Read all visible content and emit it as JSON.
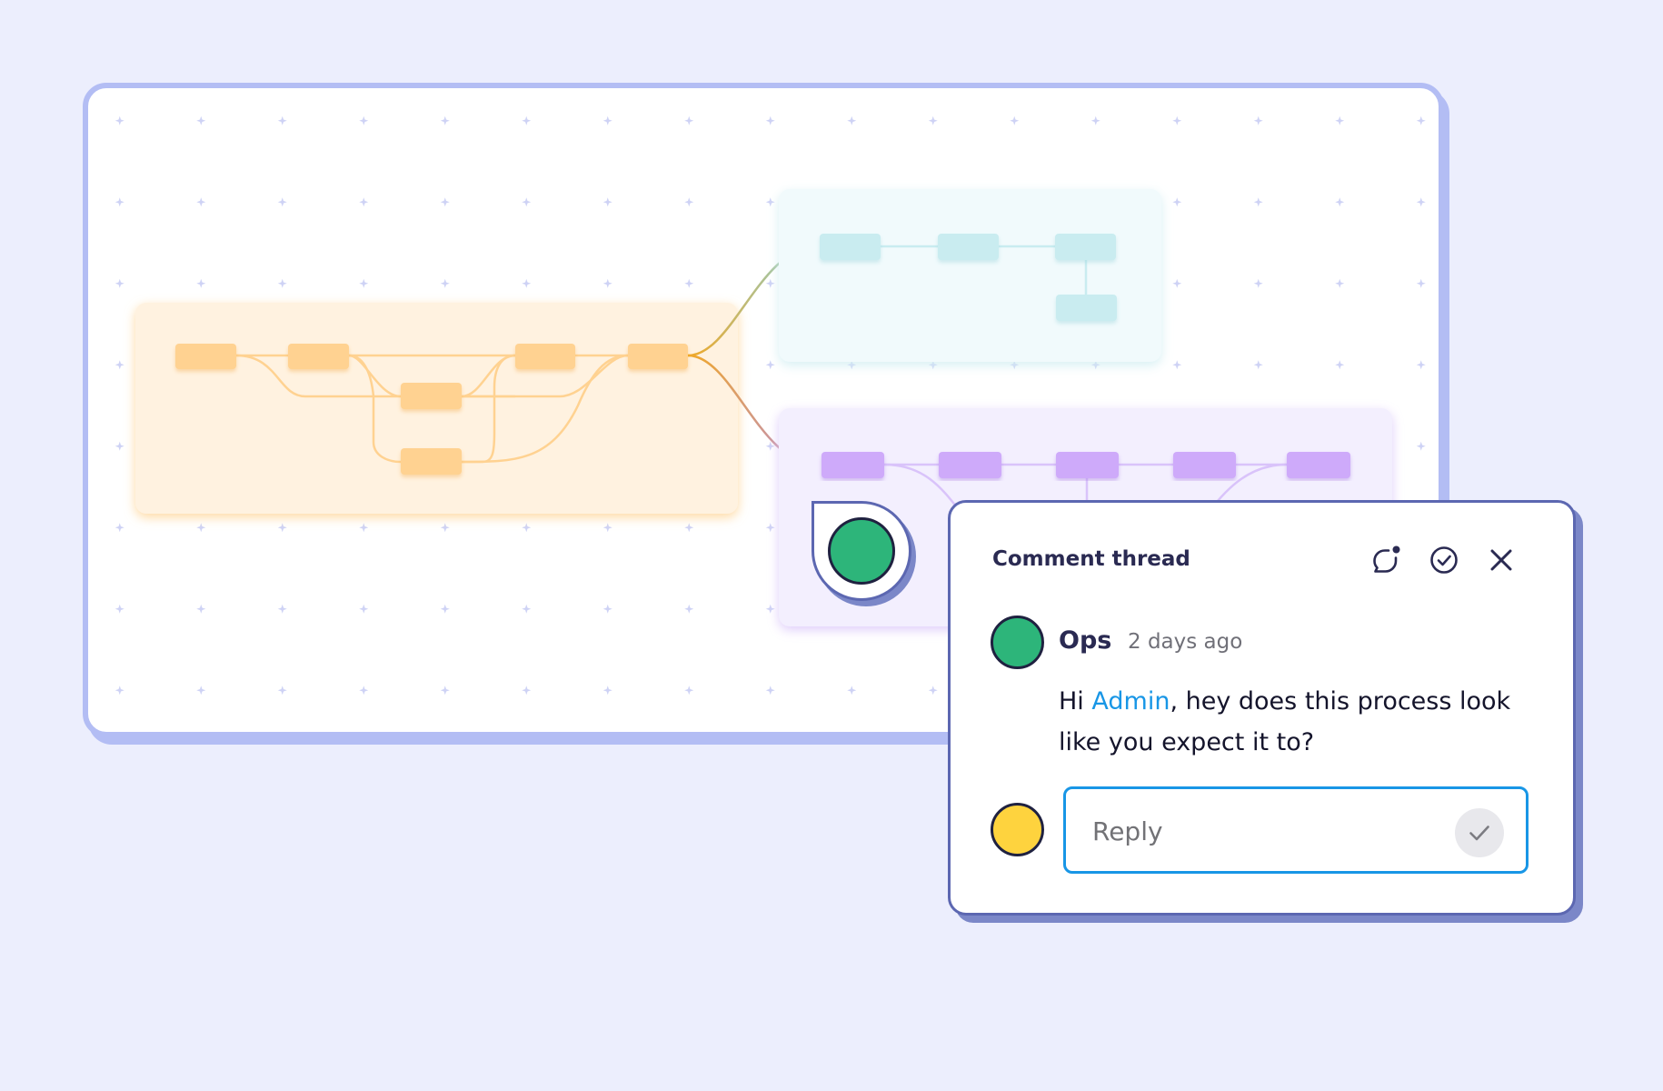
{
  "comment_thread": {
    "title": "Comment thread",
    "header_icons": [
      "comment-badge-icon",
      "check-circle-icon",
      "close-icon"
    ],
    "comment": {
      "author": "Ops",
      "time": "2 days ago",
      "message_before": "Hi ",
      "mention": "Admin",
      "message_after": ", hey does this process look like you expect it to?"
    },
    "reply": {
      "placeholder": "Reply",
      "value": ""
    }
  },
  "colors": {
    "background": "#ECEEFD",
    "frame_border": "#B3BDF4",
    "card_border": "#5C67B1",
    "author_avatar": "#2DB57A",
    "user_avatar": "#FED33E",
    "mention": "#1896E6",
    "orange_node": "#FFD291",
    "teal_node": "#C9ECF0",
    "purple_node": "#CEAAFA"
  }
}
